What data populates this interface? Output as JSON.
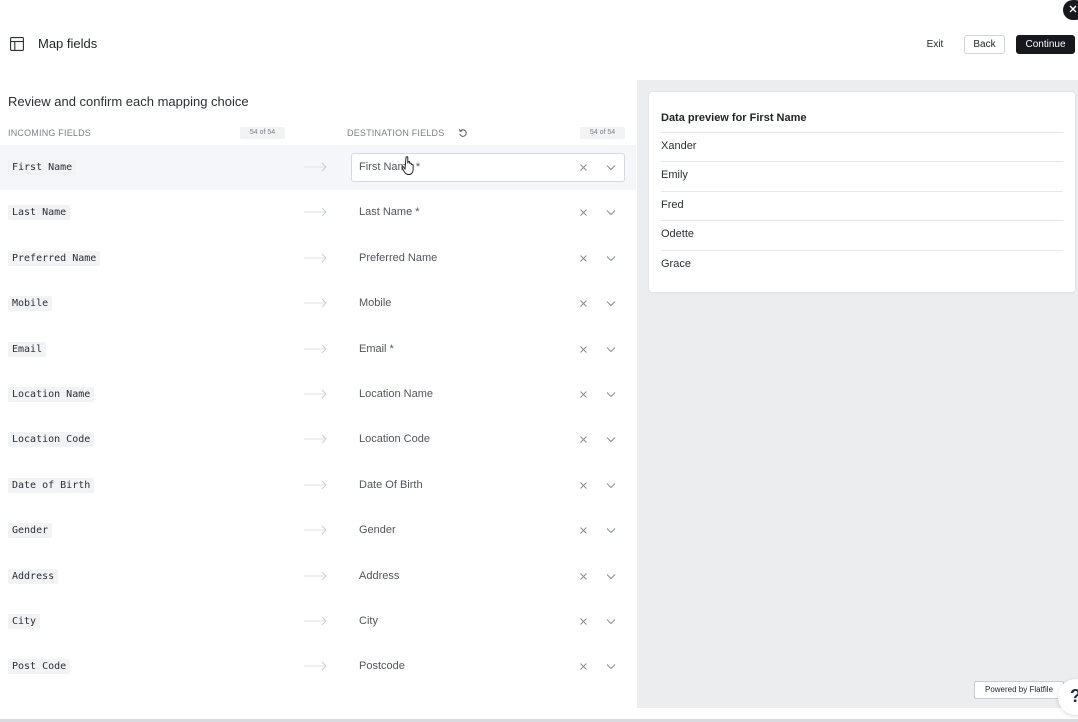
{
  "header": {
    "title": "Map fields",
    "exit_label": "Exit",
    "back_label": "Back",
    "continue_label": "Continue"
  },
  "main": {
    "review_title": "Review and confirm each mapping choice",
    "incoming_header": "INCOMING FIELDS",
    "incoming_count": "54 of 54",
    "destination_header": "DESTINATION FIELDS",
    "destination_count": "54 of 54",
    "rows": [
      {
        "source": "First Name",
        "destination": "First Name *"
      },
      {
        "source": "Last Name",
        "destination": "Last Name *"
      },
      {
        "source": "Preferred Name",
        "destination": "Preferred Name"
      },
      {
        "source": "Mobile",
        "destination": "Mobile"
      },
      {
        "source": "Email",
        "destination": "Email *"
      },
      {
        "source": "Location Name",
        "destination": "Location Name"
      },
      {
        "source": "Location Code",
        "destination": "Location Code"
      },
      {
        "source": "Date of Birth",
        "destination": "Date Of Birth"
      },
      {
        "source": "Gender",
        "destination": "Gender"
      },
      {
        "source": "Address",
        "destination": "Address"
      },
      {
        "source": "City",
        "destination": "City"
      },
      {
        "source": "Post Code",
        "destination": "Postcode"
      }
    ]
  },
  "preview": {
    "title": "Data preview for First Name",
    "values": [
      "Xander",
      "Emily",
      "Fred",
      "Odette",
      "Grace"
    ]
  },
  "footer": {
    "powered_by": "Powered by Flatfile",
    "help_glyph": "?"
  },
  "icons": {
    "header_icon": "table-icon",
    "reset": "reset-icon",
    "arrow": "arrow-right-icon",
    "clear": "close-icon",
    "dropdown": "chevron-down-icon"
  },
  "colors": {
    "primary_button": "#16181d",
    "selected_row": "#f4f6fa",
    "preview_background": "#ecedef"
  }
}
